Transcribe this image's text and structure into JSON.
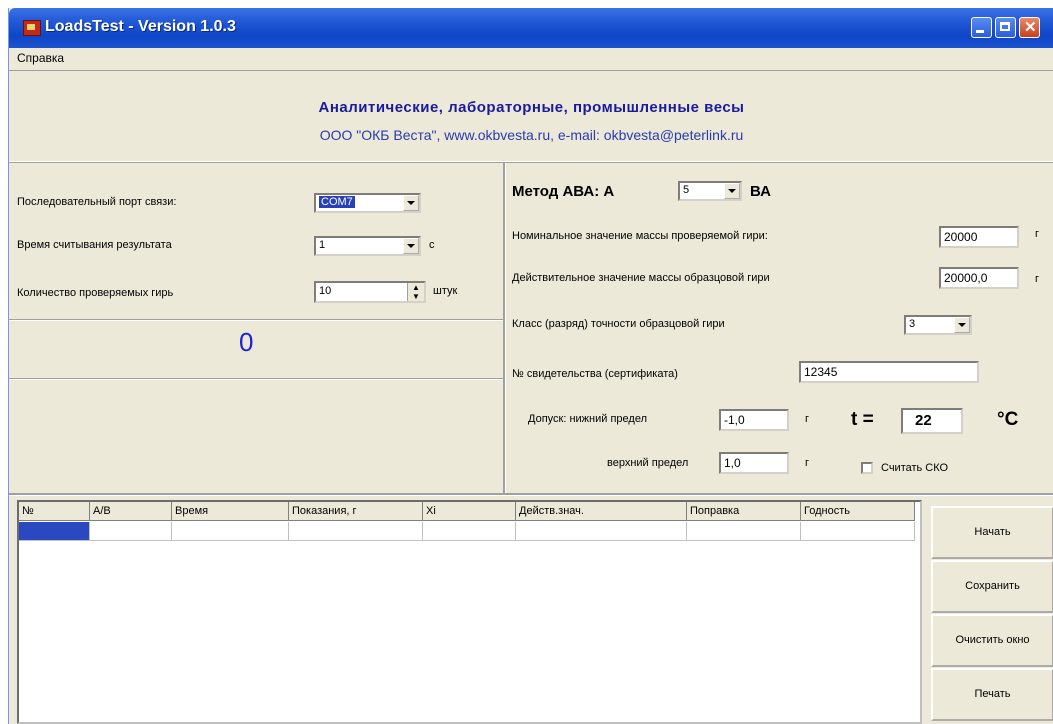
{
  "window": {
    "title": "LoadsTest - Version 1.0.3"
  },
  "menu": {
    "help": "Справка"
  },
  "header": {
    "title": "Аналитические, лабораторные, промышленные весы",
    "subtitle": "ООО \"ОКБ Веста\", www.okbvesta.ru, e-mail: okbvesta@peterlink.ru"
  },
  "left": {
    "port_label": "Последовательный порт связи:",
    "port_value": "COM7",
    "time_label": "Время считывания результата",
    "time_value": "1",
    "time_unit": "с",
    "count_label": "Количество проверяемых гирь",
    "count_value": "10",
    "count_unit": "штук",
    "counter": "0"
  },
  "right": {
    "method_label": "Метод АВА: А",
    "method_value": "5",
    "method_suffix": "ВА",
    "nominal_label": "Номинальное значение  массы проверяемой гири:",
    "nominal_value": "20000",
    "nominal_unit": "г",
    "actual_label": "Действительное значение массы образцовой гири",
    "actual_value": "20000,0",
    "actual_unit": "г",
    "class_label": "Класс (разряд) точности образцовой гири",
    "class_value": "3",
    "cert_label": "№ свидетельства (сертификата)",
    "cert_value": "12345",
    "tol_low_label": "Допуск:  нижний предел",
    "tol_low_value": "-1,0",
    "tol_low_unit": "г",
    "tol_high_label": "верхний предел",
    "tol_high_value": "1,0",
    "tol_high_unit": "г",
    "temp_label": "t =",
    "temp_value": "22",
    "temp_unit": "°С",
    "sko_label": "Считать СКО"
  },
  "table": {
    "columns": [
      "№",
      "А/В",
      "Время",
      "Показания, г",
      "Xi",
      "Действ.знач.",
      "Поправка",
      "Годность"
    ]
  },
  "buttons": {
    "start": "Начать",
    "save": "Сохранить",
    "clear": "Очистить окно",
    "print": "Печать"
  }
}
